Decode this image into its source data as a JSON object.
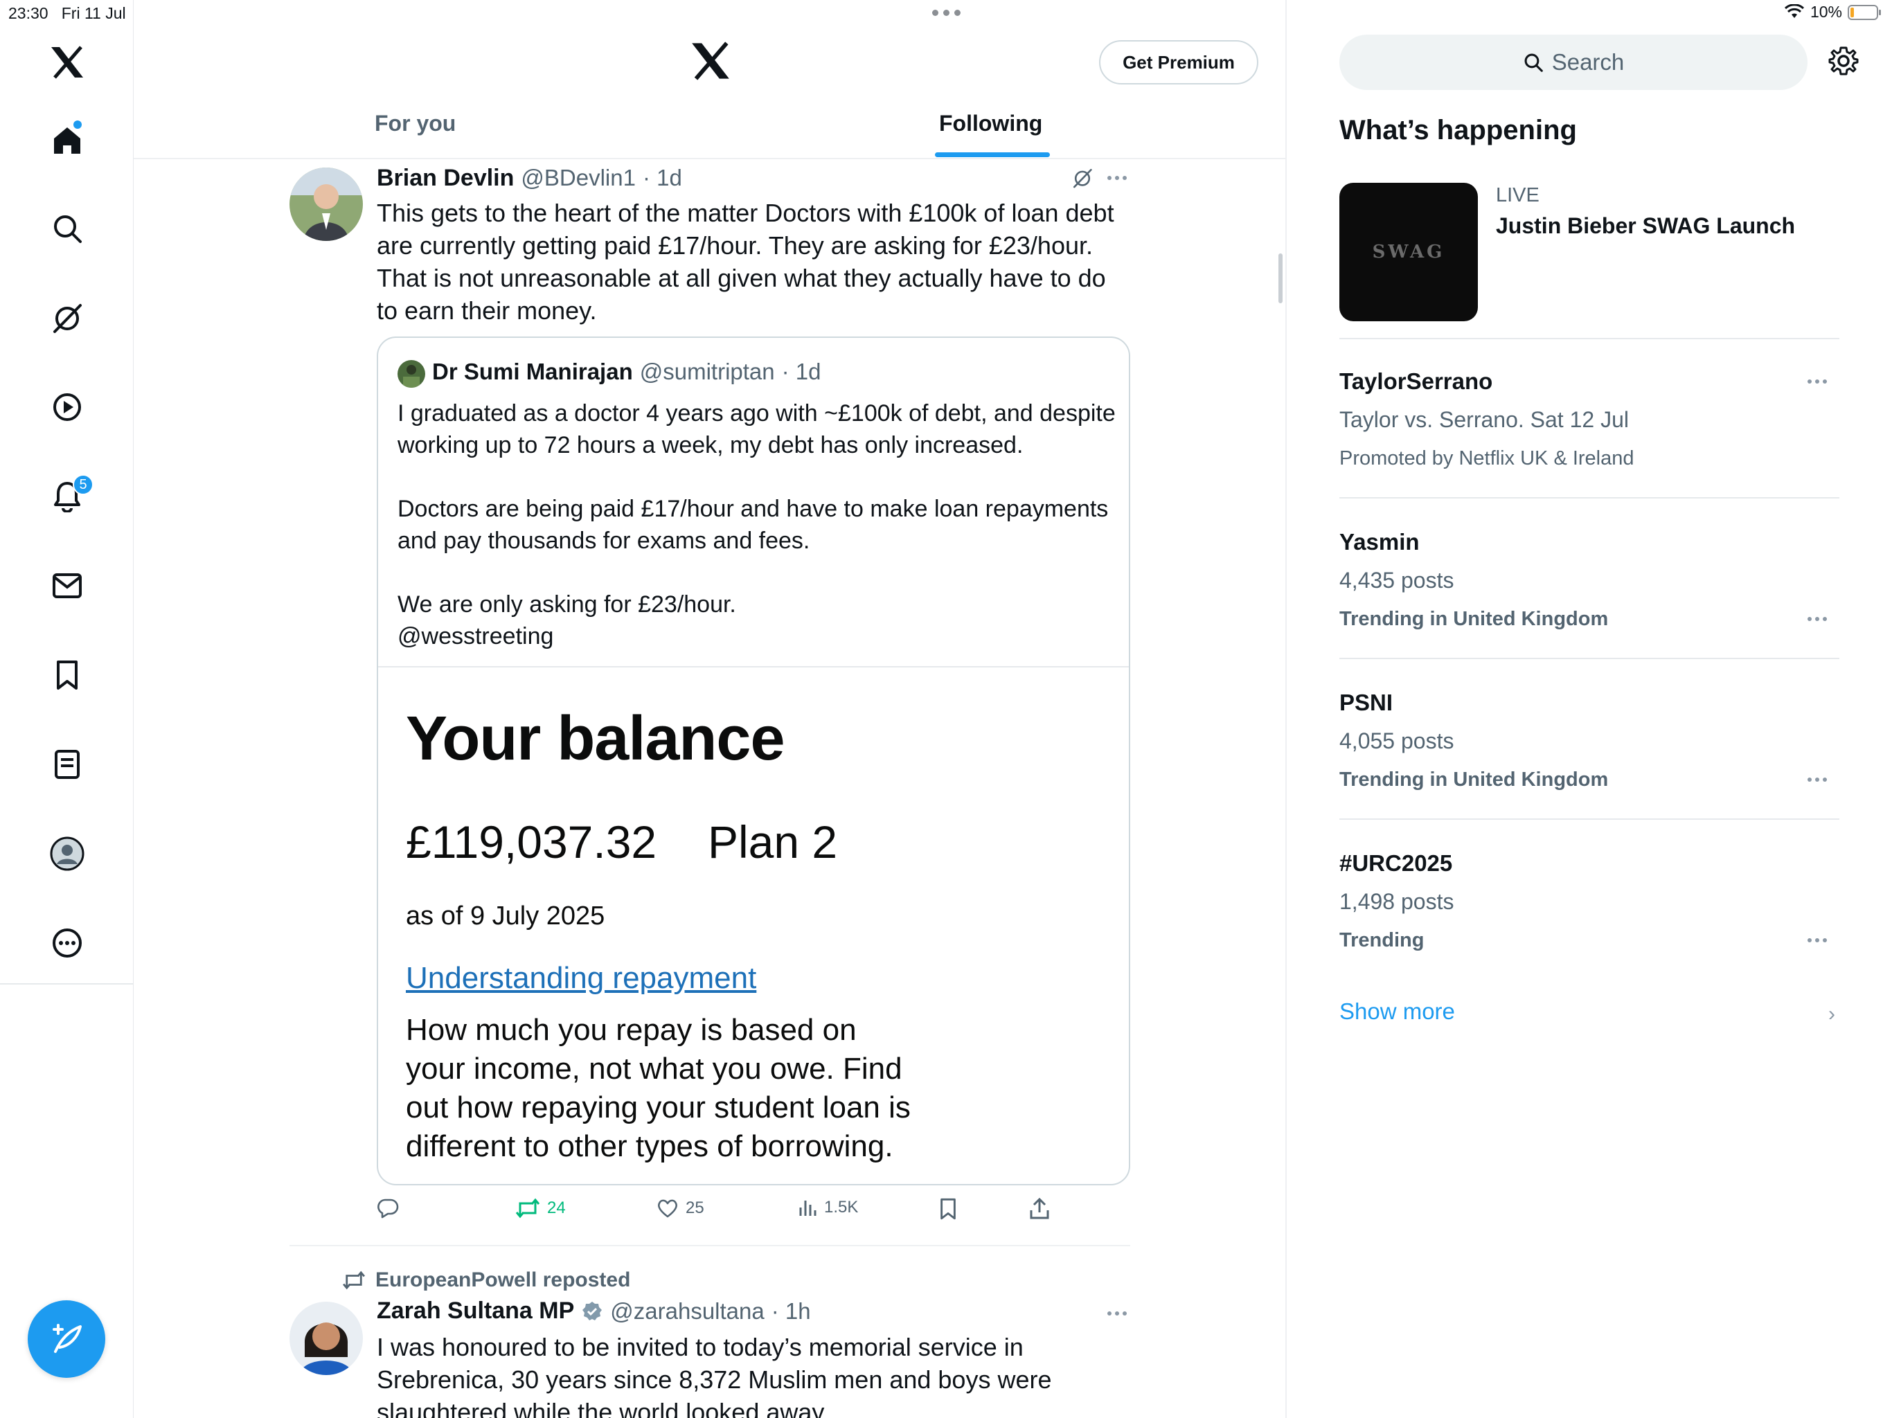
{
  "status_bar": {
    "time": "23:30",
    "date": "Fri 11 Jul",
    "battery": "10%"
  },
  "nav": {
    "notifications_badge": "5",
    "items": [
      "logo",
      "home",
      "explore",
      "grok",
      "video",
      "notifications",
      "messages",
      "bookmarks",
      "lists",
      "profile",
      "more"
    ]
  },
  "header": {
    "premium_label": "Get Premium"
  },
  "tabs": [
    {
      "label": "For you"
    },
    {
      "label": "Following"
    }
  ],
  "tweets": [
    {
      "name": "Brian Devlin",
      "handle": "@BDevlin1",
      "time": "· 1d",
      "text": "This gets  to the heart of the matter Doctors with £100k of loan debt are currently getting paid £17/hour. They are asking for £23/hour. That is not unreasonable at all given what they actually have to do to earn their money.",
      "quote": {
        "name": "Dr Sumi Manirajan",
        "handle": "@sumitriptan",
        "time": "· 1d",
        "para1": "I graduated as a doctor 4 years ago with ~£100k of debt, and despite working up to 72 hours a week, my debt has only increased.",
        "para2": "Doctors are being paid £17/hour and have to make loan repayments and pay thousands for exams and fees.",
        "para3": "We are only asking for £23/hour.",
        "para4": "@wesstreeting",
        "image": {
          "title": "Your balance",
          "amount": "£119,037.32",
          "plan": "Plan 2",
          "as_of": "as of 9 July 2025",
          "link": "Understanding repayment",
          "desc": "How much you repay is based on your income, not what you owe. Find out how repaying your student loan is different to other types of borrowing."
        }
      },
      "actions": {
        "reposts": "24",
        "likes": "25",
        "views": "1.5K"
      }
    },
    {
      "reposted_by": "EuropeanPowell reposted",
      "name": "Zarah Sultana MP",
      "handle": "@zarahsultana",
      "time": "· 1h",
      "text": "I was honoured to be invited to today’s memorial service in Srebrenica, 30 years since 8,372 Muslim men and boys were slaughtered while the world looked away."
    }
  ],
  "sidebar": {
    "search_placeholder": "Search",
    "title": "What’s happening",
    "live": {
      "label": "LIVE",
      "title": "Justin Bieber SWAG Launch",
      "image_text": "SWAG"
    },
    "trends": [
      {
        "title": "TaylorSerrano",
        "sub": "Taylor vs. Serrano. Sat 12 Jul",
        "meta": "Promoted by Netflix UK & Ireland"
      },
      {
        "title": "Yasmin",
        "sub": "4,435 posts",
        "meta": "Trending in United Kingdom"
      },
      {
        "title": "PSNI",
        "sub": "4,055 posts",
        "meta": "Trending in United Kingdom"
      },
      {
        "title": "#URC2025",
        "sub": "1,498 posts",
        "meta": "Trending"
      }
    ],
    "show_more": "Show more"
  },
  "colors": {
    "accent": "#1d9bf0",
    "repost_green": "#00ba7c",
    "link_blue": "#1d70b8"
  }
}
